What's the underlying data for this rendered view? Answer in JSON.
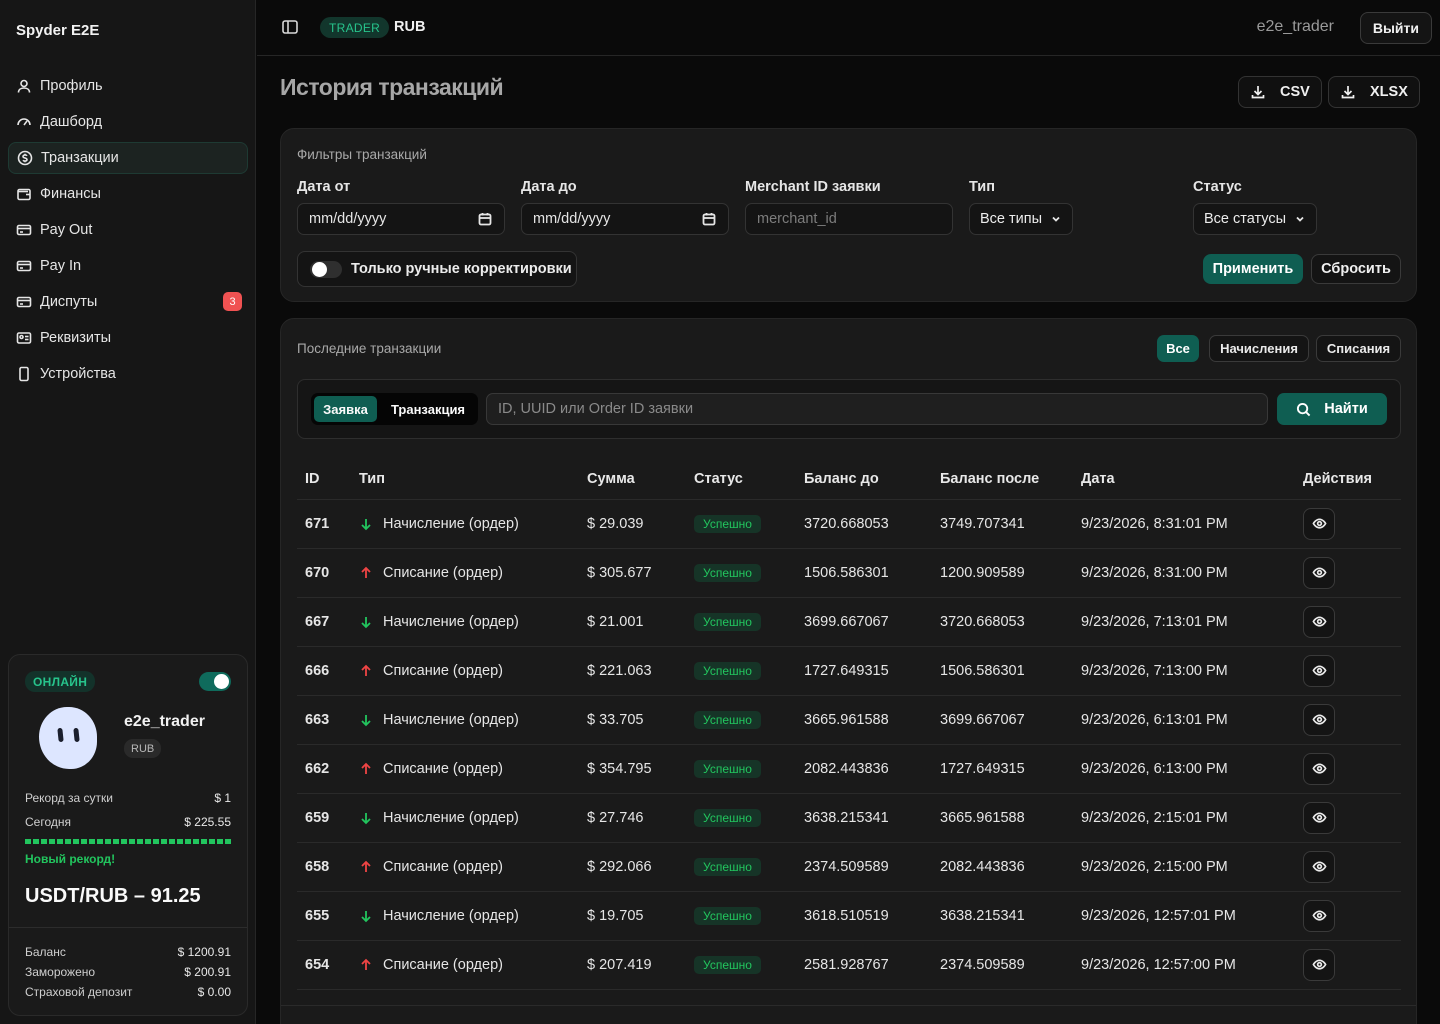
{
  "app": {
    "brand": "Spyder E2E"
  },
  "sidebar": {
    "items": [
      {
        "label": "Профиль",
        "icon": "user-icon"
      },
      {
        "label": "Дашборд",
        "icon": "gauge-icon"
      },
      {
        "label": "Транзакции",
        "icon": "dollar-circle-icon",
        "active": true
      },
      {
        "label": "Финансы",
        "icon": "wallet-icon"
      },
      {
        "label": "Pay Out",
        "icon": "card-out-icon"
      },
      {
        "label": "Pay In",
        "icon": "card-in-icon"
      },
      {
        "label": "Диспуты",
        "icon": "card-dispute-icon",
        "badge": "3"
      },
      {
        "label": "Реквизиты",
        "icon": "id-card-icon"
      },
      {
        "label": "Устройства",
        "icon": "phone-icon"
      }
    ],
    "card": {
      "status": "ОНЛАЙН",
      "online": true,
      "username": "e2e_trader",
      "currency": "RUB",
      "record_label": "Рекорд за сутки",
      "record_value": "$ 1",
      "today_label": "Сегодня",
      "today_value": "$ 225.55",
      "progress": 1.0,
      "new_record": "Новый рекорд!",
      "rate": "USDT/RUB – 91.25",
      "balance_label": "Баланс",
      "balance_value": "$ 1200.91",
      "frozen_label": "Заморожено",
      "frozen_value": "$ 200.91",
      "deposit_label": "Страховой депозит",
      "deposit_value": "$ 0.00"
    }
  },
  "header": {
    "role": "TRADER",
    "currency": "RUB",
    "username": "e2e_trader",
    "logout": "Выйти"
  },
  "page": {
    "title": "История транзакций",
    "export_csv": "CSV",
    "export_xlsx": "XLSX"
  },
  "filters": {
    "title": "Фильтры транзакций",
    "date_from_label": "Дата от",
    "date_from_value": "mm/dd/yyyy",
    "date_to_label": "Дата до",
    "date_to_value": "mm/dd/yyyy",
    "merchant_label": "Merchant ID заявки",
    "merchant_placeholder": "merchant_id",
    "type_label": "Тип",
    "type_value": "Все типы",
    "status_label": "Статус",
    "status_value": "Все статусы",
    "manual_toggle": "Только ручные корректировки",
    "apply": "Применить",
    "reset": "Сбросить"
  },
  "transactions": {
    "title": "Последние транзакции",
    "tabs": [
      "Все",
      "Начисления",
      "Списания"
    ],
    "seg": [
      "Заявка",
      "Транзакция"
    ],
    "search_placeholder": "ID, UUID или Order ID заявки",
    "find": "Найти",
    "columns": [
      "ID",
      "Тип",
      "Сумма",
      "Статус",
      "Баланс до",
      "Баланс после",
      "Дата",
      "Действия"
    ],
    "rows": [
      {
        "id": "671",
        "type": "Начисление (ордер)",
        "dir": "down",
        "amount": "$ 29.039",
        "status": "Успешно",
        "before": "3720.668053",
        "after": "3749.707341",
        "date": "9/23/2026, 8:31:01 PM"
      },
      {
        "id": "670",
        "type": "Списание (ордер)",
        "dir": "up",
        "amount": "$ 305.677",
        "status": "Успешно",
        "before": "1506.586301",
        "after": "1200.909589",
        "date": "9/23/2026, 8:31:00 PM"
      },
      {
        "id": "667",
        "type": "Начисление (ордер)",
        "dir": "down",
        "amount": "$ 21.001",
        "status": "Успешно",
        "before": "3699.667067",
        "after": "3720.668053",
        "date": "9/23/2026, 7:13:01 PM"
      },
      {
        "id": "666",
        "type": "Списание (ордер)",
        "dir": "up",
        "amount": "$ 221.063",
        "status": "Успешно",
        "before": "1727.649315",
        "after": "1506.586301",
        "date": "9/23/2026, 7:13:00 PM"
      },
      {
        "id": "663",
        "type": "Начисление (ордер)",
        "dir": "down",
        "amount": "$ 33.705",
        "status": "Успешно",
        "before": "3665.961588",
        "after": "3699.667067",
        "date": "9/23/2026, 6:13:01 PM"
      },
      {
        "id": "662",
        "type": "Списание (ордер)",
        "dir": "up",
        "amount": "$ 354.795",
        "status": "Успешно",
        "before": "2082.443836",
        "after": "1727.649315",
        "date": "9/23/2026, 6:13:00 PM"
      },
      {
        "id": "659",
        "type": "Начисление (ордер)",
        "dir": "down",
        "amount": "$ 27.746",
        "status": "Успешно",
        "before": "3638.215341",
        "after": "3665.961588",
        "date": "9/23/2026, 2:15:01 PM"
      },
      {
        "id": "658",
        "type": "Списание (ордер)",
        "dir": "up",
        "amount": "$ 292.066",
        "status": "Успешно",
        "before": "2374.509589",
        "after": "2082.443836",
        "date": "9/23/2026, 2:15:00 PM"
      },
      {
        "id": "655",
        "type": "Начисление (ордер)",
        "dir": "down",
        "amount": "$ 19.705",
        "status": "Успешно",
        "before": "3618.510519",
        "after": "3638.215341",
        "date": "9/23/2026, 12:57:01 PM"
      },
      {
        "id": "654",
        "type": "Списание (ордер)",
        "dir": "up",
        "amount": "$ 207.419",
        "status": "Успешно",
        "before": "2581.928767",
        "after": "2374.509589",
        "date": "9/23/2026, 12:57:00 PM"
      }
    ]
  },
  "colors": {
    "accent": "#0f5e52",
    "success": "#22c55e",
    "danger": "#ef4444",
    "background": "#0a0a0a",
    "panel": "#1a1a1a"
  }
}
